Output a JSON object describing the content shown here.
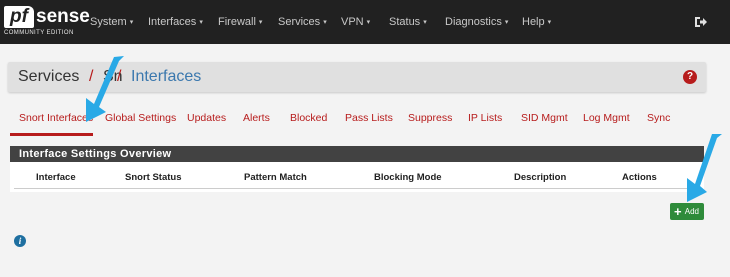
{
  "brand": {
    "logo_mark": "pf",
    "logo_word": "sense",
    "edition": "COMMUNITY EDITION"
  },
  "navbar": {
    "items": [
      {
        "label": "System",
        "caret": "▾"
      },
      {
        "label": "Interfaces",
        "caret": "▾"
      },
      {
        "label": "Firewall",
        "caret": "▾"
      },
      {
        "label": "Services",
        "caret": "▾"
      },
      {
        "label": "VPN",
        "caret": "▾"
      },
      {
        "label": "Status",
        "caret": "▾"
      },
      {
        "label": "Diagnostics",
        "caret": "▾"
      },
      {
        "label": "Help",
        "caret": "▾"
      }
    ],
    "logout_icon": "sign-out-icon"
  },
  "breadcrumb": {
    "parent": "Services",
    "separator": "/",
    "middle": "Sn",
    "current": "Interfaces",
    "help_glyph": "?"
  },
  "tabs": [
    {
      "label": "Snort Interfaces",
      "active": true
    },
    {
      "label": "Global Settings",
      "active": false
    },
    {
      "label": "Updates",
      "active": false
    },
    {
      "label": "Alerts",
      "active": false
    },
    {
      "label": "Blocked",
      "active": false
    },
    {
      "label": "Pass Lists",
      "active": false
    },
    {
      "label": "Suppress",
      "active": false
    },
    {
      "label": "IP Lists",
      "active": false
    },
    {
      "label": "SID Mgmt",
      "active": false
    },
    {
      "label": "Log Mgmt",
      "active": false
    },
    {
      "label": "Sync",
      "active": false
    }
  ],
  "panel": {
    "title": "Interface Settings Overview",
    "columns": [
      "Interface",
      "Snort Status",
      "Pattern Match",
      "Blocking Mode",
      "Description",
      "Actions"
    ]
  },
  "add_button": {
    "label": "Add",
    "icon": "plus-icon"
  },
  "info_glyph": "i",
  "colors": {
    "navbar_bg": "#212121",
    "accent_red": "#b71c1c",
    "link_blue": "#1e6fa0",
    "add_green": "#2e8b3a",
    "annotation_arrow": "#29a9e6"
  }
}
